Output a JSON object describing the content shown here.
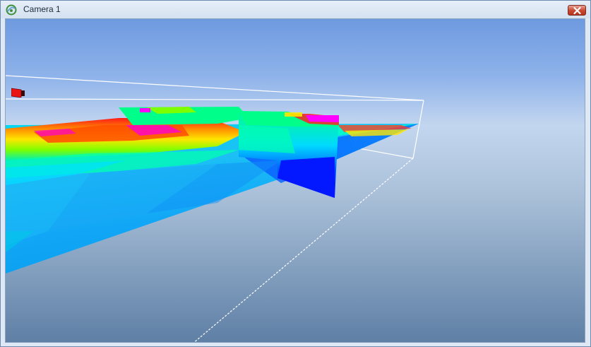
{
  "window": {
    "title": "Camera 1",
    "app_icon": "app-logo-icon",
    "close_icon": "close-icon"
  },
  "viewport": {
    "scene": "3d-volume-slices",
    "camera_icon": "camera-icon",
    "colors": {
      "sky_top": "#6e9ae0",
      "horizon": "#c3d6ef",
      "ground": "#5f7fa5",
      "bounding_box": "#ffffff",
      "camera_marker": "#e81515"
    },
    "colormap": [
      "#0000ff",
      "#0080ff",
      "#00e5ff",
      "#00ff9a",
      "#7dff00",
      "#ffff00",
      "#ff9900",
      "#ff0000",
      "#ff00ff"
    ]
  }
}
